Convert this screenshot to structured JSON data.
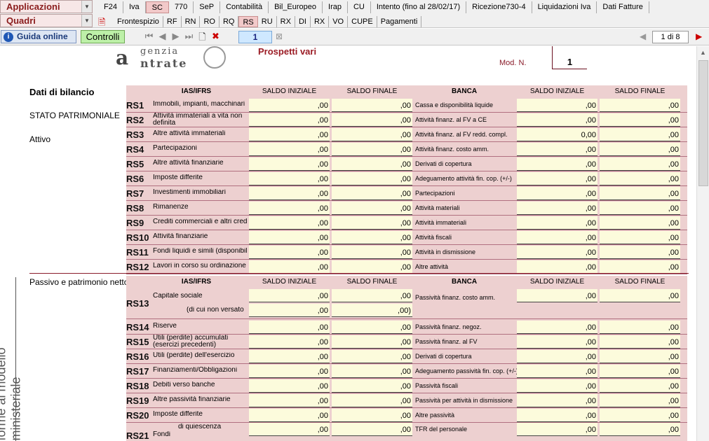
{
  "header": {
    "app_label": "Applicazioni",
    "quadri_label": "Quadri",
    "tabs": [
      "F24",
      "Iva",
      "SC",
      "770",
      "SeP",
      "Contabilità",
      "Bil_Europeo",
      "Irap",
      "CU",
      "Intento (fino al 28/02/17)",
      "Ricezione730-4",
      "Liquidazioni Iva",
      "Dati Fatture"
    ],
    "active_tab": "SC",
    "subtabs": [
      "Frontespizio",
      "RF",
      "RN",
      "RO",
      "RQ",
      "RS",
      "RU",
      "RX",
      "DI",
      "RX",
      "VO",
      "CUPE",
      "Pagamenti"
    ],
    "active_subtab": "RS"
  },
  "toolbar": {
    "guide_label": "Guida online",
    "controls_label": "Controlli",
    "page_value": "1",
    "page_of": "1 di 8"
  },
  "form": {
    "logo_top": "genzia",
    "logo_bottom": "ntrate",
    "logo_letter": "a",
    "title": "Prospetti vari",
    "mod_label": "Mod. N.",
    "mod_value": "1",
    "side_text": "forme al modello ministeriale",
    "section1": {
      "heading": "Dati di bilancio",
      "sub1": "STATO PATRIMONIALE",
      "sub2": "Attivo",
      "col_ias": "IAS/IFRS",
      "col_si": "SALDO INIZIALE",
      "col_sf": "SALDO FINALE",
      "col_banca": "BANCA",
      "rows": [
        {
          "code": "RS1",
          "label": "Immobili, impianti, macchinari",
          "label2": "Cassa e disponibilità liquide",
          "v1": ",00",
          "v2": ",00",
          "v3": ",00",
          "v4": ",00"
        },
        {
          "code": "RS2",
          "label": "Attività immateriali a vita non definita",
          "label2": "Attività finanz. al FV a CE",
          "v1": ",00",
          "v2": ",00",
          "v3": ",00",
          "v4": ",00"
        },
        {
          "code": "RS3",
          "label": "Altre attività immateriali",
          "label2": "Attività finanz. al FV redd. compl.",
          "v1": ",00",
          "v2": ",00",
          "v3": "0,00",
          "v4": ",00"
        },
        {
          "code": "RS4",
          "label": "Partecipazioni",
          "label2": "Attività finanz. costo amm.",
          "v1": ",00",
          "v2": ",00",
          "v3": ",00",
          "v4": ",00"
        },
        {
          "code": "RS5",
          "label": "Altre attività finanziarie",
          "label2": "Derivati di copertura",
          "v1": ",00",
          "v2": ",00",
          "v3": ",00",
          "v4": ",00"
        },
        {
          "code": "RS6",
          "label": "Imposte differite",
          "label2": "Adeguamento attività fin. cop. (+/-)",
          "v1": ",00",
          "v2": ",00",
          "v3": ",00",
          "v4": ",00"
        },
        {
          "code": "RS7",
          "label": "Investimenti immobiliari",
          "label2": "Partecipazioni",
          "v1": ",00",
          "v2": ",00",
          "v3": ",00",
          "v4": ",00"
        },
        {
          "code": "RS8",
          "label": "Rimanenze",
          "label2": "Attività materiali",
          "v1": ",00",
          "v2": ",00",
          "v3": ",00",
          "v4": ",00"
        },
        {
          "code": "RS9",
          "label": "Crediti commerciali e altri crediti",
          "label2": "Attività immateriali",
          "v1": ",00",
          "v2": ",00",
          "v3": ",00",
          "v4": ",00"
        },
        {
          "code": "RS10",
          "label": "Attività finanziarie",
          "label2": "Attività fiscali",
          "v1": ",00",
          "v2": ",00",
          "v3": ",00",
          "v4": ",00"
        },
        {
          "code": "RS11",
          "label": "Fondi liquidi e simili (disponibilità)",
          "label2": "Attività in dismissione",
          "v1": ",00",
          "v2": ",00",
          "v3": ",00",
          "v4": ",00"
        },
        {
          "code": "RS12",
          "label": "Lavori in corso su ordinazione",
          "label2": "Altre attività",
          "v1": ",00",
          "v2": ",00",
          "v3": ",00",
          "v4": ",00"
        }
      ]
    },
    "section2": {
      "heading": "Passivo e patrimonio netto",
      "col_ias": "IAS/IFRS",
      "col_si": "SALDO INIZIALE",
      "col_sf": "SALDO FINALE",
      "col_banca": "BANCA",
      "rs13": {
        "code": "RS13",
        "label": "Capitale sociale",
        "sublabel": "(di cui non versato",
        "label2": "Passività finanz. costo amm.",
        "v1": ",00",
        "v2": ",00",
        "v3": ",00",
        "v4": ",00",
        "v5": ",00",
        "v6": ",00)"
      },
      "rows": [
        {
          "code": "RS14",
          "label": "Riserve",
          "label2": "Passività finanz. negoz.",
          "v1": ",00",
          "v2": ",00",
          "v3": ",00",
          "v4": ",00"
        },
        {
          "code": "RS15",
          "label": "Utili (perdite) accumulati (esercizi precedenti)",
          "label2": "Passività finanz. al FV",
          "v1": ",00",
          "v2": ",00",
          "v3": ",00",
          "v4": ",00"
        },
        {
          "code": "RS16",
          "label": "Utili (perdite) dell'esercizio",
          "label2": "Derivati di copertura",
          "v1": ",00",
          "v2": ",00",
          "v3": ",00",
          "v4": ",00"
        },
        {
          "code": "RS17",
          "label": "Finanziamenti/Obbligazioni",
          "label2": "Adeguamento passività fin. cop. (+/-)",
          "v1": ",00",
          "v2": ",00",
          "v3": ",00",
          "v4": ",00"
        },
        {
          "code": "RS18",
          "label": "Debiti verso banche",
          "label2": "Passività fiscali",
          "v1": ",00",
          "v2": ",00",
          "v3": ",00",
          "v4": ",00"
        },
        {
          "code": "RS19",
          "label": "Altre passività finanziarie",
          "label2": "Passività per attività in dismissione",
          "v1": ",00",
          "v2": ",00",
          "v3": ",00",
          "v4": ",00"
        },
        {
          "code": "RS20",
          "label": "Imposte differite",
          "label2": "Altre passività",
          "v1": ",00",
          "v2": ",00",
          "v3": ",00",
          "v4": ",00"
        }
      ],
      "rs21": {
        "code": "RS21",
        "label": "Fondi",
        "sublabel": "di quiescenza",
        "label2": "TFR del personale",
        "v1": ",00",
        "v2": ",00",
        "v3": ",00",
        "v4": ",00"
      }
    }
  }
}
